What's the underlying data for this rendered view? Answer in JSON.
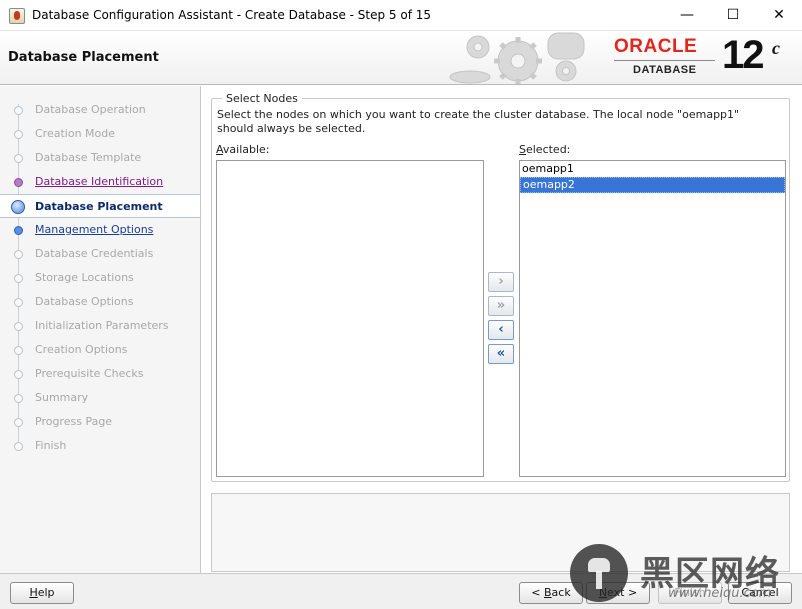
{
  "window": {
    "title": "Database Configuration Assistant - Create Database - Step 5 of 15",
    "minimize": "—",
    "maximize": "☐",
    "close": "✕"
  },
  "header": {
    "title": "Database Placement",
    "brand": "ORACLE",
    "product": "DATABASE",
    "version": "12",
    "version_suffix": "c",
    "brand_color": "#e2261d"
  },
  "nav": {
    "items": [
      {
        "label": "Database Operation",
        "state": "disabled"
      },
      {
        "label": "Creation Mode",
        "state": "disabled"
      },
      {
        "label": "Database Template",
        "state": "disabled"
      },
      {
        "label": "Database Identification",
        "state": "visited"
      },
      {
        "label": "Database Placement",
        "state": "active"
      },
      {
        "label": "Management Options",
        "state": "link"
      },
      {
        "label": "Database Credentials",
        "state": "disabled"
      },
      {
        "label": "Storage Locations",
        "state": "disabled"
      },
      {
        "label": "Database Options",
        "state": "disabled"
      },
      {
        "label": "Initialization Parameters",
        "state": "disabled"
      },
      {
        "label": "Creation Options",
        "state": "disabled"
      },
      {
        "label": "Prerequisite Checks",
        "state": "disabled"
      },
      {
        "label": "Summary",
        "state": "disabled"
      },
      {
        "label": "Progress Page",
        "state": "disabled"
      },
      {
        "label": "Finish",
        "state": "disabled"
      }
    ]
  },
  "main": {
    "group_title": "Select Nodes",
    "description": "Select the nodes on which you want to create the cluster database. The local node \"oemapp1\" should always be selected.",
    "available_label_mnemonic": "A",
    "available_label_rest": "vailable:",
    "selected_label_mnemonic": "S",
    "selected_label_rest": "elected:",
    "available_nodes": [],
    "selected_nodes": [
      {
        "name": "oemapp1",
        "selected": false
      },
      {
        "name": "oemapp2",
        "selected": true
      }
    ],
    "move_buttons": {
      "move_right": {
        "glyph": "›",
        "icon": "move-right-icon",
        "enabled": false
      },
      "move_all_right": {
        "glyph": "»",
        "icon": "move-all-right-icon",
        "enabled": false
      },
      "move_left": {
        "glyph": "‹",
        "icon": "move-left-icon",
        "enabled": true
      },
      "move_all_left": {
        "glyph": "«",
        "icon": "move-all-left-icon",
        "enabled": true
      }
    }
  },
  "footer": {
    "help_mnemonic": "H",
    "help_rest": "elp",
    "back_prefix": "< ",
    "back_mnemonic": "B",
    "back_rest": "ack",
    "next_mnemonic": "N",
    "next_rest": "ext >",
    "finish_label": "Finish",
    "cancel_label": "Cancel"
  },
  "watermark": {
    "chinese": "黑区网络",
    "url": "www.heiqu.com"
  }
}
